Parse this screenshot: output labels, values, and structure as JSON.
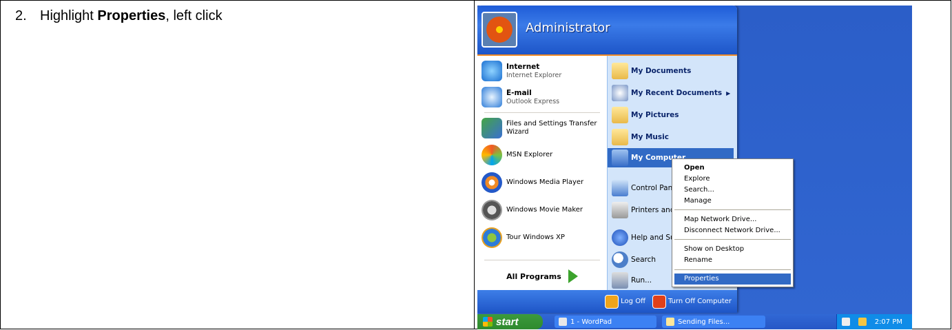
{
  "instruction": {
    "number": "2.",
    "prefix": "Highlight ",
    "bold": "Properties",
    "suffix": ", left click"
  },
  "start_menu": {
    "user": "Administrator",
    "pinned": [
      {
        "title": "Internet",
        "subtitle": "Internet Explorer",
        "icon": "internet-explorer-icon"
      },
      {
        "title": "E-mail",
        "subtitle": "Outlook Express",
        "icon": "outlook-express-icon"
      }
    ],
    "recent": [
      {
        "label_line1": "Files and Settings Transfer",
        "label_line2": "Wizard",
        "icon": "transfer-wizard-icon"
      },
      {
        "label": "MSN Explorer",
        "icon": "msn-butterfly-icon"
      },
      {
        "label": "Windows Media Player",
        "icon": "media-player-icon"
      },
      {
        "label": "Windows Movie Maker",
        "icon": "movie-maker-icon"
      },
      {
        "label": "Tour Windows XP",
        "icon": "tour-xp-icon"
      }
    ],
    "all_programs": "All Programs",
    "places": [
      {
        "label": "My Documents",
        "icon": "folder-icon"
      },
      {
        "label": "My Recent Documents",
        "icon": "recent-documents-icon"
      },
      {
        "label": "My Pictures",
        "icon": "folder-icon"
      },
      {
        "label": "My Music",
        "icon": "folder-icon"
      },
      {
        "label": "My Computer",
        "icon": "computer-icon"
      },
      {
        "label": "Control Pane",
        "icon": "control-panel-icon"
      },
      {
        "label": "Printers and",
        "icon": "printer-icon"
      },
      {
        "label": "Help and Su",
        "icon": "help-icon"
      },
      {
        "label": "Search",
        "icon": "search-icon"
      },
      {
        "label": "Run...",
        "icon": "run-icon"
      }
    ],
    "footer": {
      "logoff": "Log Off",
      "turnoff": "Turn Off Computer"
    }
  },
  "context_menu": {
    "items": [
      "Open",
      "Explore",
      "Search...",
      "Manage",
      "Map Network Drive...",
      "Disconnect Network Drive...",
      "Show on Desktop",
      "Rename",
      "Properties"
    ],
    "selected": "Properties"
  },
  "taskbar": {
    "start": "start",
    "buttons": [
      "1 - WordPad",
      "Sending Files..."
    ],
    "clock": "2:07 PM"
  }
}
